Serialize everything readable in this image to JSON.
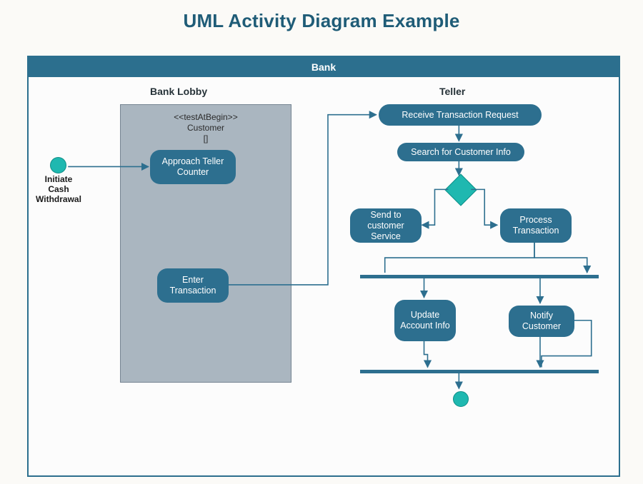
{
  "title": "UML Activity Diagram Example",
  "container_name": "Bank",
  "lanes": {
    "lobby": "Bank Lobby",
    "teller": "Teller"
  },
  "expansion": {
    "stereotype": "<<testAtBegin>>",
    "name": "Customer",
    "bracket": "[]"
  },
  "start": "Initiate Cash Withdrawal",
  "activities": {
    "approach": "Approach Teller Counter",
    "enter": "Enter Transaction",
    "receive": "Receive Transaction Request",
    "search": "Search for Customer Info",
    "send_cs": "Send to customer Service",
    "process": "Process Transaction",
    "update": "Update Account Info",
    "notify": "Notify Customer"
  },
  "colors": {
    "accent": "#2d6f8f",
    "node": "#1fb8b0"
  }
}
